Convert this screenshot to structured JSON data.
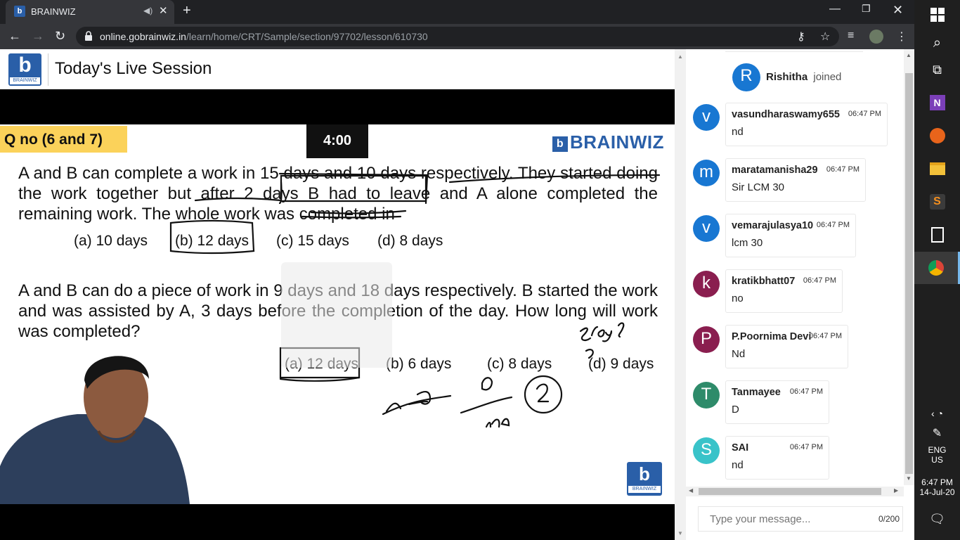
{
  "browser": {
    "tab_title": "BRAINWIZ",
    "new_tab": "+",
    "url_host": "online.gobrainwiz.in",
    "url_path": "/learn/home/CRT/Sample/section/97702/lesson/610730"
  },
  "header": {
    "logo_text": "BRAINWIZ",
    "title": "Today's Live Session"
  },
  "slide": {
    "question_no": "Q no (6 and 7)",
    "timer": "4:00",
    "brand": "BRAINWIZ",
    "q1": "A and B can complete a work in 15 days and 10 days respectively. They started doing the work together but after 2 days B had to leave and A alone completed the remaining work. The whole work was completed in",
    "q1_options": [
      "(a) 10 days",
      "(b) 12 days",
      "(c) 15 days",
      "(d) 8 days"
    ],
    "q2": "A and B can do a piece of work in 9 days and 18 days respectively. B started the work and was assisted by A, 3 days before the completion of the day. How long will work was completed?",
    "q2_options": [
      "(a) 12 days",
      "(b) 6 days",
      "(c) 8 days",
      "(d) 9 days"
    ],
    "footer_logo": "BRAINWIZ"
  },
  "chat": {
    "join_notice": {
      "initial": "R",
      "name": "Rishitha",
      "action": "joined",
      "color": "#1877d2"
    },
    "messages": [
      {
        "initial": "v",
        "name": "vasundharaswamy655",
        "time": "06:47 PM",
        "text": "nd",
        "color": "#1877d2"
      },
      {
        "initial": "m",
        "name": "maratamanisha29",
        "time": "06:47 PM",
        "text": "Sir LCM 30",
        "color": "#1877d2"
      },
      {
        "initial": "v",
        "name": "vemarajulasya10",
        "time": "06:47 PM",
        "text": "lcm 30",
        "color": "#1877d2"
      },
      {
        "initial": "k",
        "name": "kratikbhatt07",
        "time": "06:47 PM",
        "text": "no",
        "color": "#8a1e4f"
      },
      {
        "initial": "P",
        "name": "P.Poornima Devi",
        "time": "06:47 PM",
        "text": "Nd",
        "color": "#8a1e4f"
      },
      {
        "initial": "T",
        "name": "Tanmayee",
        "time": "06:47 PM",
        "text": "D",
        "color": "#2e8b6a"
      },
      {
        "initial": "S",
        "name": "SAI",
        "time": "06:47 PM",
        "text": "nd",
        "color": "#39c3c9"
      }
    ],
    "input_placeholder": "Type your message...",
    "char_count": "0/200"
  },
  "taskbar": {
    "lang": "ENG",
    "region": "US",
    "time": "6:47 PM",
    "date": "14-Jul-20"
  }
}
